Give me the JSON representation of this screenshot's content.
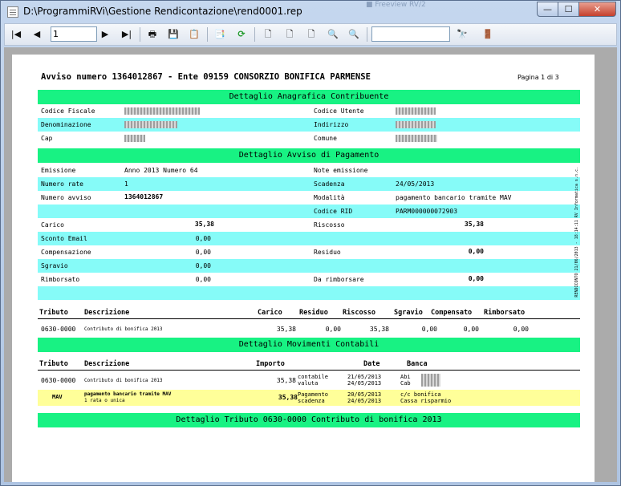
{
  "window": {
    "title": "D:\\ProgrammiRVi\\Gestione Rendicontazione\\rend0001.rep",
    "ghost_title": "■ Freeview RV/2",
    "buttons": {
      "min": "—",
      "max": "☐",
      "close": "✕"
    }
  },
  "toolbar": {
    "first": "|◀",
    "prev": "◀",
    "page_value": "1",
    "next": "▶",
    "last": "▶|",
    "print": "🖶",
    "save": "💾",
    "export": "📋",
    "copy": "📑",
    "refresh": "⟳",
    "page1": "🗋",
    "page2": "🗋",
    "page3": "🗋",
    "zoom_out": "🔍",
    "zoom_in": "🔍",
    "search_value": "",
    "find": "🔭",
    "exit": "🚪"
  },
  "report": {
    "title": "Avviso numero 1364012867 - Ente 09159 CONSORZIO BONIFICA PARMENSE",
    "page": "Pagina 1 di 3",
    "section1": "Dettaglio Anagrafica Contribuente",
    "anagrafica": {
      "codice_fiscale": "Codice Fiscale",
      "codice_utente": "Codice Utente",
      "denominazione": "Denominazione",
      "indirizzo": "Indirizzo",
      "cap": "Cap",
      "comune": "Comune"
    },
    "section2": "Dettaglio Avviso di Pagamento",
    "avviso": {
      "emissione_l": "Emissione",
      "emissione_v": "Anno 2013 Numero 64",
      "note_l": "Note emissione",
      "numero_rate_l": "Numero rate",
      "numero_rate_v": "1",
      "scadenza_l": "Scadenza",
      "scadenza_v": "24/05/2013",
      "numero_avviso_l": "Numero avviso",
      "numero_avviso_v": "1364012867",
      "modalita_l": "Modalità",
      "modalita_v": "pagamento bancario tramite MAV",
      "codice_rid_l": "Codice RID",
      "codice_rid_v": "PARM000000072903",
      "carico_l": "Carico",
      "carico_v": "35,38",
      "riscosso_l": "Riscosso",
      "riscosso_v": "35,38",
      "sconto_l": "Sconto Email",
      "sconto_v": "0,00",
      "compensazione_l": "Compensazione",
      "compensazione_v": "0,00",
      "residuo_l": "Residuo",
      "residuo_v": "0,00",
      "sgravio_l": "Sgravio",
      "sgravio_v": "0,00",
      "rimborsato_l": "Rimborsato",
      "rimborsato_v": "0,00",
      "da_rimborsare_l": "Da rimborsare",
      "da_rimborsare_v": "0,00"
    },
    "tributi_headers": {
      "tributo": "Tributo",
      "descrizione": "Descrizione",
      "carico": "Carico",
      "residuo": "Residuo",
      "riscosso": "Riscosso",
      "sgravio": "Sgravio",
      "compensato": "Compensato",
      "rimborsato": "Rimborsato"
    },
    "tributo_row": {
      "tributo": "0630-0000",
      "descrizione": "Contributo di bonifica 2013",
      "carico": "35,38",
      "residuo": "0,00",
      "riscosso": "35,38",
      "sgravio": "0,00",
      "compensato": "0,00",
      "rimborsato": "0,00"
    },
    "section3": "Dettaglio Movimenti Contabili",
    "movimenti_headers": {
      "tributo": "Tributo",
      "descrizione": "Descrizione",
      "importo": "Importo",
      "date": "Date",
      "banca": "Banca"
    },
    "movimento1": {
      "tributo": "0630-0000",
      "descrizione": "Contributo di bonifica 2013",
      "importo": "35,38",
      "tipo1": "contabile",
      "tipo2": "valuta",
      "data1": "21/05/2013",
      "data2": "24/05/2013",
      "banca1": "Abi",
      "banca2": "Cab"
    },
    "movimento2": {
      "tributo": "MAV",
      "descrizione1": "pagamento bancario tramite MAV",
      "descrizione2": "1 rata o unica",
      "importo": "35,38",
      "tipo1": "Pagamento",
      "tipo2": "scadenza",
      "data1": "20/05/2013",
      "data2": "24/05/2013",
      "banca1": "c/c bonifica",
      "banca2": "Cassa risparmio"
    },
    "section4": "Dettaglio Tributo 0630-0000 Contributo di bonifica 2013",
    "vertical_text": "RENDICONTO 21/06/2013 - 18:14:11 RV Informatica s.n.c."
  },
  "colors": {
    "band": "#18f283",
    "cyan": "#86fbf8",
    "yellow": "#ffff99"
  }
}
